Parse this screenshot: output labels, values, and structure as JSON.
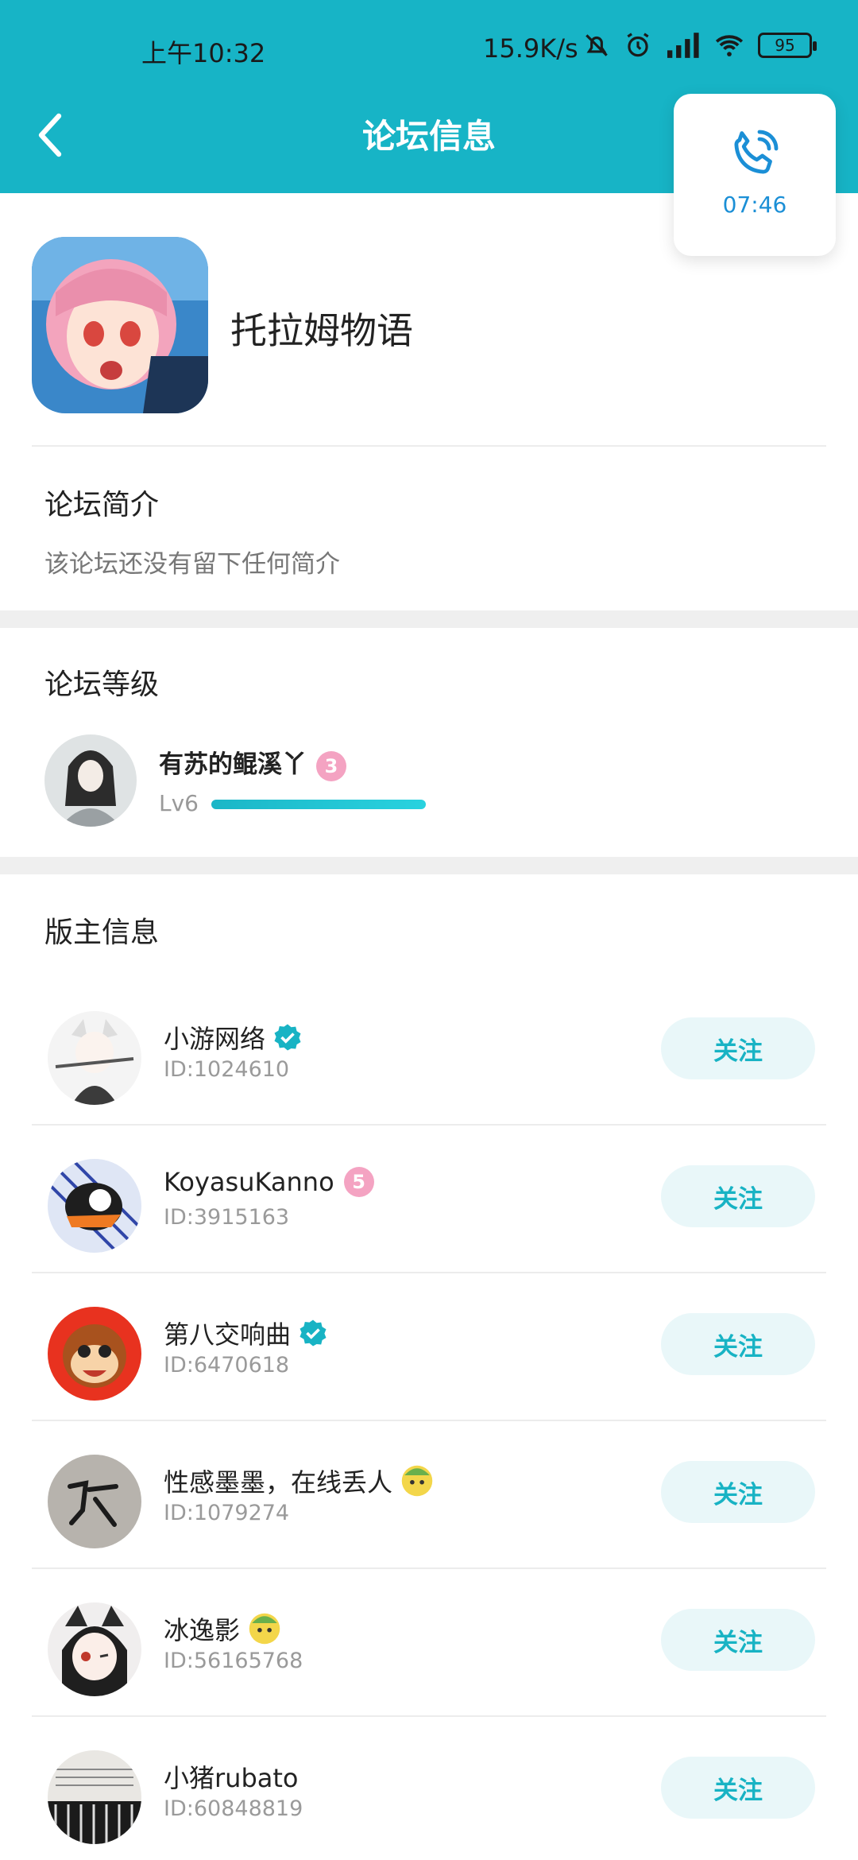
{
  "status_bar": {
    "time": "上午10:32",
    "net_rate": "15.9K/s",
    "battery": "95"
  },
  "header": {
    "title": "论坛信息",
    "back_icon": "chevron-left-icon"
  },
  "call_overlay": {
    "icon": "phone-icon",
    "timer": "07:46"
  },
  "forum": {
    "name": "托拉姆物语"
  },
  "intro": {
    "title": "论坛简介",
    "text": "该论坛还没有留下任何简介"
  },
  "level": {
    "title": "论坛等级",
    "user_name": "有苏的鲲溪丫",
    "badge": "3",
    "level_label": "Lv6"
  },
  "moderators": {
    "title": "版主信息",
    "follow_label": "关注",
    "items": [
      {
        "name": "小游网络",
        "id": "ID:1024610",
        "badge": "verified"
      },
      {
        "name": "KoyasuKanno",
        "id": "ID:3915163",
        "badge": "5"
      },
      {
        "name": "第八交响曲",
        "id": "ID:6470618",
        "badge": "verified"
      },
      {
        "name": "性感墨墨，在线丢人",
        "id": "ID:1079274",
        "badge": "avatar-emoji"
      },
      {
        "name": "冰逸影",
        "id": "ID:56165768",
        "badge": "avatar-emoji"
      },
      {
        "name": "小猪rubato",
        "id": "ID:60848819",
        "badge": ""
      }
    ]
  },
  "colors": {
    "brand": "#17b4c6",
    "follow_bg": "#e9f7f9",
    "badge_pink": "#f4a3c2"
  }
}
